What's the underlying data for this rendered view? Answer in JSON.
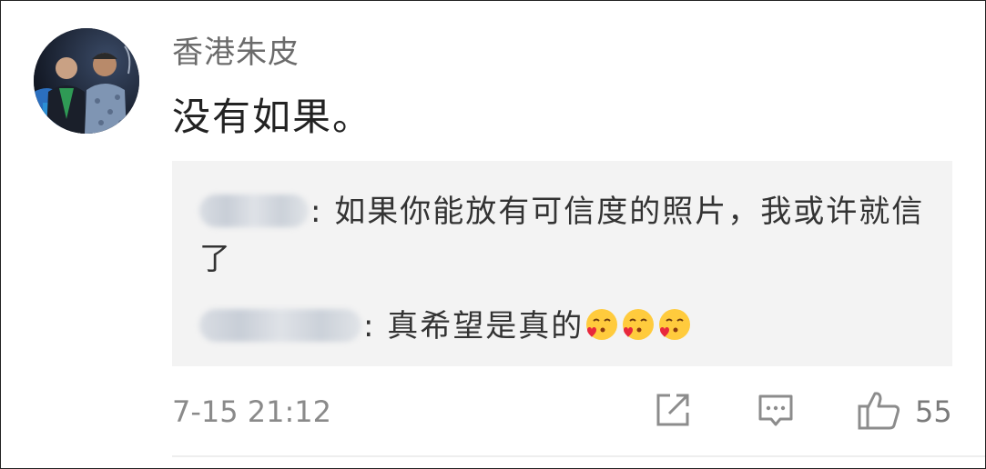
{
  "comment": {
    "username": "香港朱皮",
    "text": "没有如果。",
    "timestamp": "7-15 21:12",
    "like_count": "55"
  },
  "replies": [
    {
      "text": ": 如果你能放有可信度的照片，我或许就信了"
    },
    {
      "text": ": 真希望是真的"
    }
  ],
  "icons": {
    "share": "share-icon",
    "comment": "comment-icon",
    "like": "thumbs-up-icon",
    "emoji": "kissing-face-heart-emoji"
  },
  "colors": {
    "username": "#6b6b6b",
    "text": "#222222",
    "reply_bg": "#f3f3f3",
    "meta": "#8a8a8a"
  }
}
